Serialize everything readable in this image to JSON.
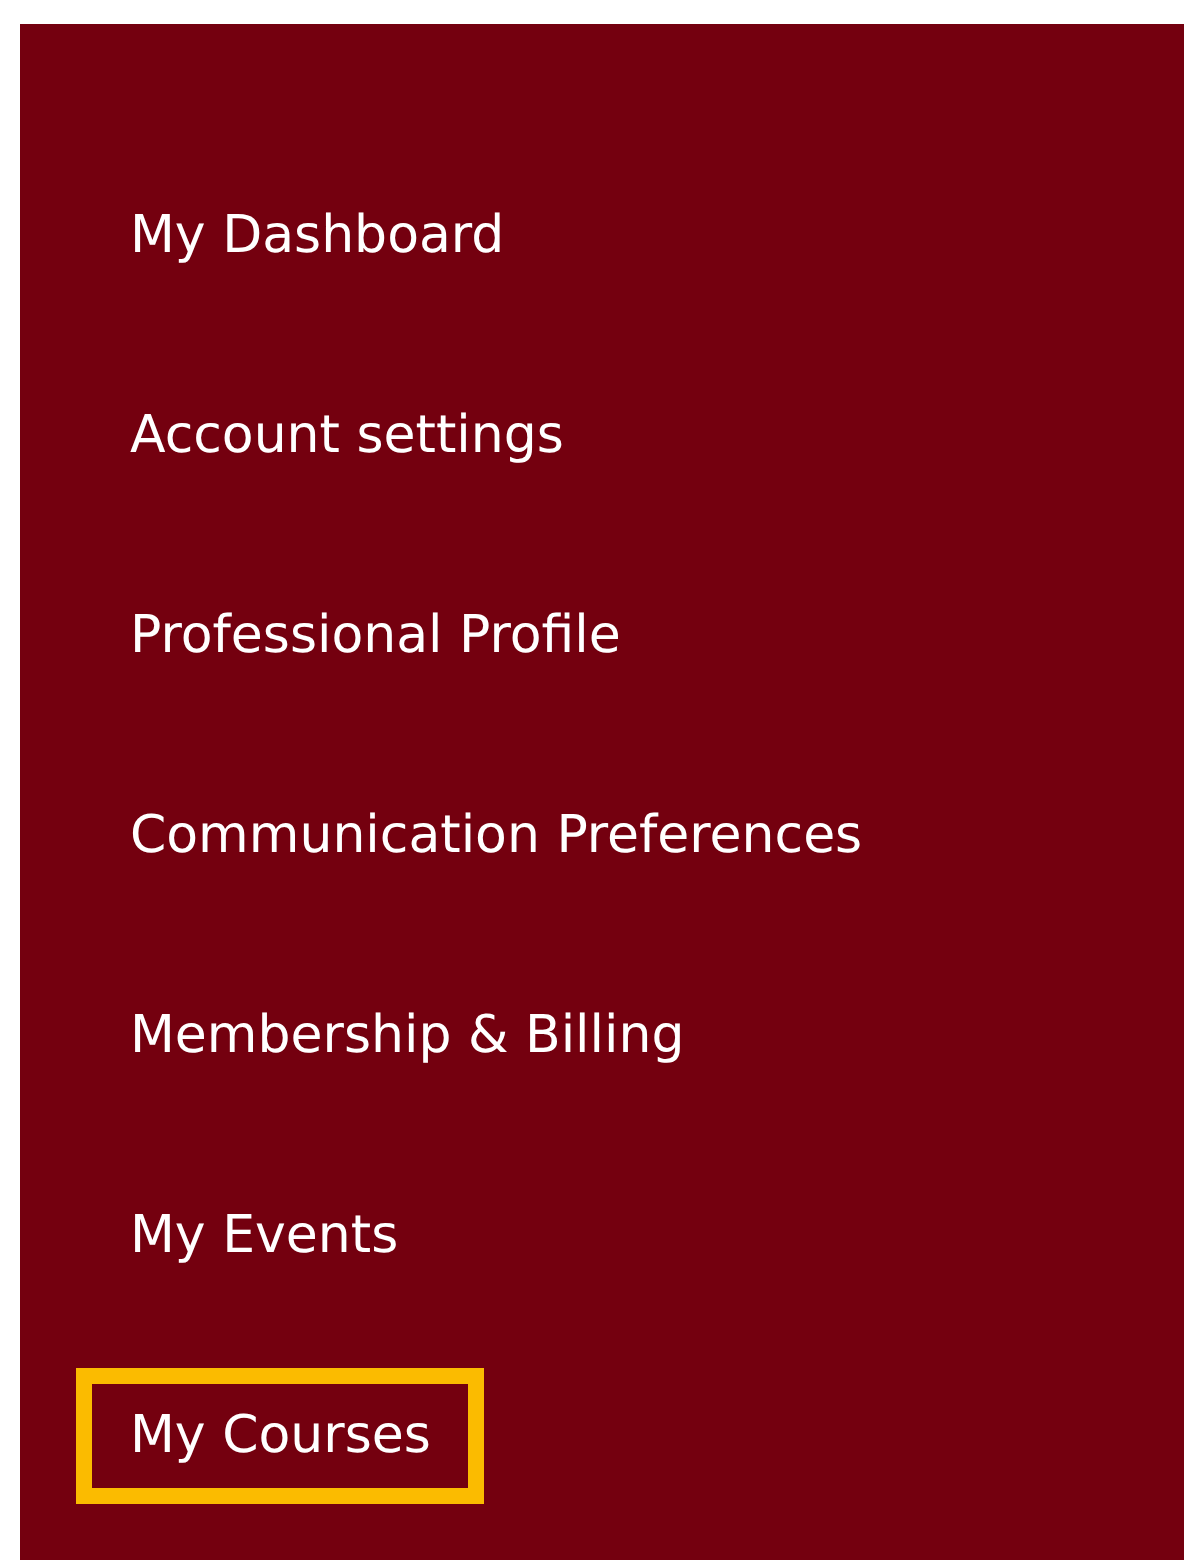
{
  "sidebar": {
    "items": [
      {
        "label": "My Dashboard",
        "highlighted": false
      },
      {
        "label": "Account settings",
        "highlighted": false
      },
      {
        "label": "Professional Profile",
        "highlighted": false
      },
      {
        "label": "Communication Preferences",
        "highlighted": false
      },
      {
        "label": "Membership & Billing",
        "highlighted": false
      },
      {
        "label": "My Events",
        "highlighted": false
      },
      {
        "label": "My Courses",
        "highlighted": true
      }
    ]
  }
}
